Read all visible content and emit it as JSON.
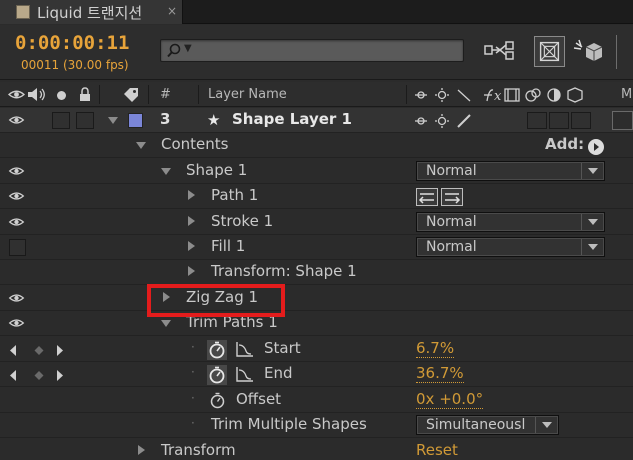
{
  "tab": {
    "title": "Liquid 트랜지션",
    "close": "×"
  },
  "header": {
    "timecode": "0:00:00:11",
    "frames_fps": "00011 (30.00 fps)",
    "search_placeholder": ""
  },
  "columns": {
    "number": "#",
    "layer_name": "Layer Name",
    "more": "M"
  },
  "layer": {
    "number": "3",
    "name": "Shape Layer 1",
    "label_color": "#7b86d8"
  },
  "rows": {
    "contents": "Contents",
    "add_label": "Add:",
    "shape1": "Shape 1",
    "path1": "Path 1",
    "stroke1": "Stroke 1",
    "fill1": "Fill 1",
    "transform_shape": "Transform: Shape 1",
    "zigzag": "Zig Zag 1",
    "trim_paths": "Trim Paths 1",
    "start": "Start",
    "end": "End",
    "offset": "Offset",
    "trim_multiple": "Trim Multiple Shapes",
    "transform": "Transform"
  },
  "values": {
    "shape1_mode": "Normal",
    "stroke1_mode": "Normal",
    "fill1_mode": "Normal",
    "start": "6.7%",
    "end": "36.7%",
    "offset": "0x +0.0°",
    "trim_multiple": "Simultaneousl",
    "transform_reset": "Reset"
  },
  "colors": {
    "accent_orange": "#e8a43a",
    "highlight_red": "#e41c1c"
  },
  "icons": [
    "search-icon",
    "eye-icon",
    "audio-icon",
    "solo-icon",
    "lock-icon",
    "label-icon",
    "star-icon",
    "stopwatch-icon",
    "graph-icon",
    "add-icon"
  ]
}
